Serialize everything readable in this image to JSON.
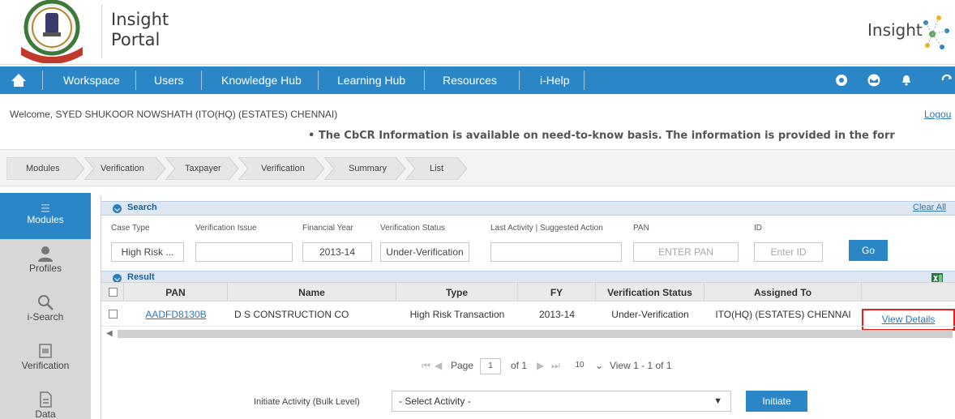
{
  "header": {
    "emblem_text": "INCOME TAX DEPARTMENT",
    "portal_title_line1": "Insight",
    "portal_title_line2": "Portal",
    "brand_word": "Insight"
  },
  "nav": {
    "items": [
      "Workspace",
      "Users",
      "Knowledge Hub",
      "Learning Hub",
      "Resources",
      "i-Help"
    ],
    "icons": [
      "home-icon",
      "settings-icon",
      "mail-icon",
      "bell-icon",
      "refresh-icon"
    ],
    "bar_color": "#2a86c6"
  },
  "welcome": {
    "text": "Welcome, SYED SHUKOOR NOWSHATH (ITO(HQ) (ESTATES) CHENNAI)",
    "logout": "Logou"
  },
  "ticker": "• The CbCR Information is available on need-to-know basis. The information is provided in the forr",
  "breadcrumb": [
    "Modules",
    "Verification",
    "Taxpayer",
    "Verification",
    "Summary",
    "List"
  ],
  "sidebar": {
    "items": [
      {
        "label": "Modules",
        "icon": "menu-icon",
        "active": true
      },
      {
        "label": "Profiles",
        "icon": "person-icon",
        "active": false
      },
      {
        "label": "i-Search",
        "icon": "search-icon",
        "active": false
      },
      {
        "label": "Verification",
        "icon": "verification-icon",
        "active": false
      },
      {
        "label": "Data",
        "icon": "document-icon",
        "active": false
      }
    ]
  },
  "search": {
    "title": "Search",
    "clear_all": "Clear All",
    "fields": {
      "case_type": {
        "label": "Case Type",
        "value": "High Risk ..."
      },
      "verification_issue": {
        "label": "Verification Issue",
        "value": ""
      },
      "financial_year": {
        "label": "Financial Year",
        "value": "2013-14"
      },
      "verification_status": {
        "label": "Verification Status",
        "value": "Under-Verification"
      },
      "last_activity": {
        "label": "Last Activity | Suggested Action",
        "value": ""
      },
      "pan": {
        "label": "PAN",
        "placeholder": "ENTER PAN"
      },
      "id": {
        "label": "ID",
        "placeholder": "Enter ID"
      }
    },
    "go": "Go"
  },
  "result": {
    "title": "Result",
    "columns": [
      "PAN",
      "Name",
      "Type",
      "FY",
      "Verification Status",
      "Assigned To"
    ],
    "rows": [
      {
        "pan": "AADFD8130B",
        "name": "D S CONSTRUCTION CO",
        "type": "High Risk Transaction",
        "fy": "2013-14",
        "status": "Under-Verification",
        "assigned_to": "ITO(HQ) (ESTATES) CHENNAI",
        "action": "View Details"
      }
    ]
  },
  "pager": {
    "page_label": "Page",
    "page_value": "1",
    "of_label": "of 1",
    "page_size": "10",
    "view_text": "View 1 - 1 of 1"
  },
  "bulk": {
    "label": "Initiate Activity (Bulk Level)",
    "select_value": "- Select Activity -",
    "button": "Initiate"
  }
}
